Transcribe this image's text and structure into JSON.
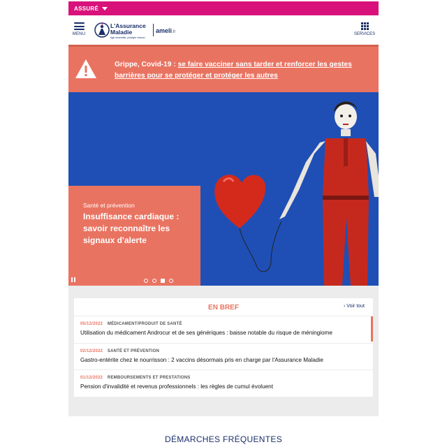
{
  "topbar": {
    "user_type": "ASSURÉ"
  },
  "header": {
    "menu_label": "MENU",
    "logo_line1": "L'Assurance",
    "logo_line2": "Maladie",
    "logo_tagline": "Agir ensemble, protéger chacun",
    "site_name": "ameli",
    "site_tld": ".fr",
    "services_label": "SERVICES"
  },
  "alert": {
    "prefix": "Grippe, Covid-19 : ",
    "link_text": "se faire vacciner sans tarder et renforcer les gestes barrières pour se protéger et protéger les autres"
  },
  "hero": {
    "kicker": "Santé et prévention",
    "title": "Insuffisance cardiaque : savoir reconnaître les signaux d'alerte",
    "slide_count": 4,
    "active_slide": 3
  },
  "bref": {
    "title": "EN BREF",
    "see_all": "› Voir tout",
    "items": [
      {
        "date": "05/12/2022",
        "category": "MÉDICAMENT/PRODUIT DE SANTÉ",
        "headline": "Utilisation du médicament Androcur et de ses génériques : baisse notable du risque de méningiome"
      },
      {
        "date": "02/12/2022",
        "category": "SANTÉ ET PRÉVENTION",
        "headline": "Gastro-entérite chez le nourrisson : 2 vaccins désormais pris en charge par l'Assurance Maladie"
      },
      {
        "date": "01/12/2022",
        "category": "REMBOURSEMENTS ET PRESTATIONS",
        "headline": "Pension d'invalidité et revenus professionnels : les règles de cumul évoluent"
      }
    ]
  },
  "demarches": {
    "title": "DÉMARCHES FRÉQUENTES"
  },
  "colors": {
    "brand_pink": "#d8127a",
    "navy": "#1a2f6b",
    "coral": "#e97361",
    "hero_blue": "#1f4fb5"
  }
}
